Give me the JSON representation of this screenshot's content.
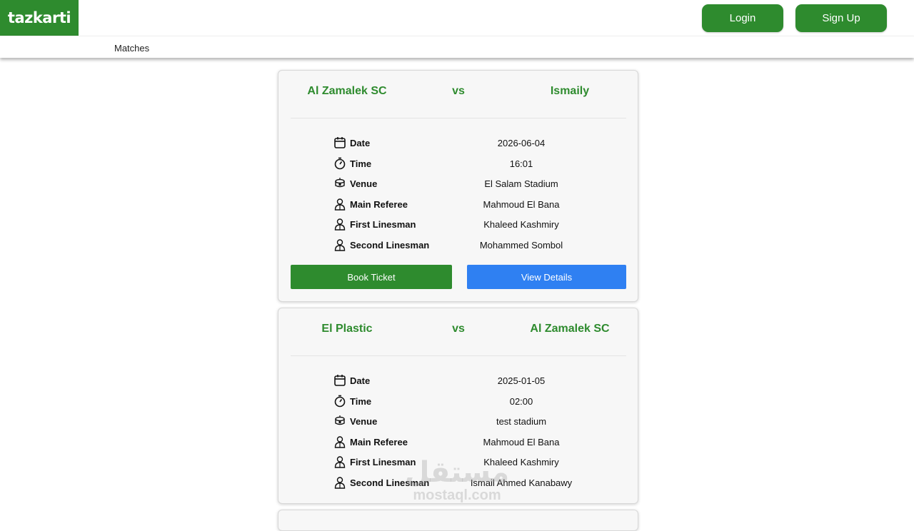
{
  "brand": {
    "logo_text": "tazkarti",
    "accent": "#2e8b2e",
    "blue": "#2f80f2"
  },
  "header": {
    "login_label": "Login",
    "signup_label": "Sign Up"
  },
  "nav": {
    "matches_label": "Matches"
  },
  "labels": {
    "date": "Date",
    "time": "Time",
    "venue": "Venue",
    "main_referee": "Main Referee",
    "first_linesman": "First Linesman",
    "second_linesman": "Second Linesman",
    "vs": "vs",
    "book": "Book Ticket",
    "view": "View Details"
  },
  "matches": [
    {
      "home": "Al Zamalek SC",
      "away": "Ismaily",
      "date": "2026-06-04",
      "time": "16:01",
      "venue": "El Salam Stadium",
      "main_referee": "Mahmoud El Bana",
      "first_linesman": "Khaleed Kashmiry",
      "second_linesman": "Mohammed Sombol"
    },
    {
      "home": "El Plastic",
      "away": "Al Zamalek SC",
      "date": "2025-01-05",
      "time": "02:00",
      "venue": "test stadium",
      "main_referee": "Mahmoud El Bana",
      "first_linesman": "Khaleed Kashmiry",
      "second_linesman": "Ismail Ahmed Kanabawy"
    }
  ],
  "watermark": {
    "arabic": "مستقل",
    "latin": "mostaql.com"
  }
}
